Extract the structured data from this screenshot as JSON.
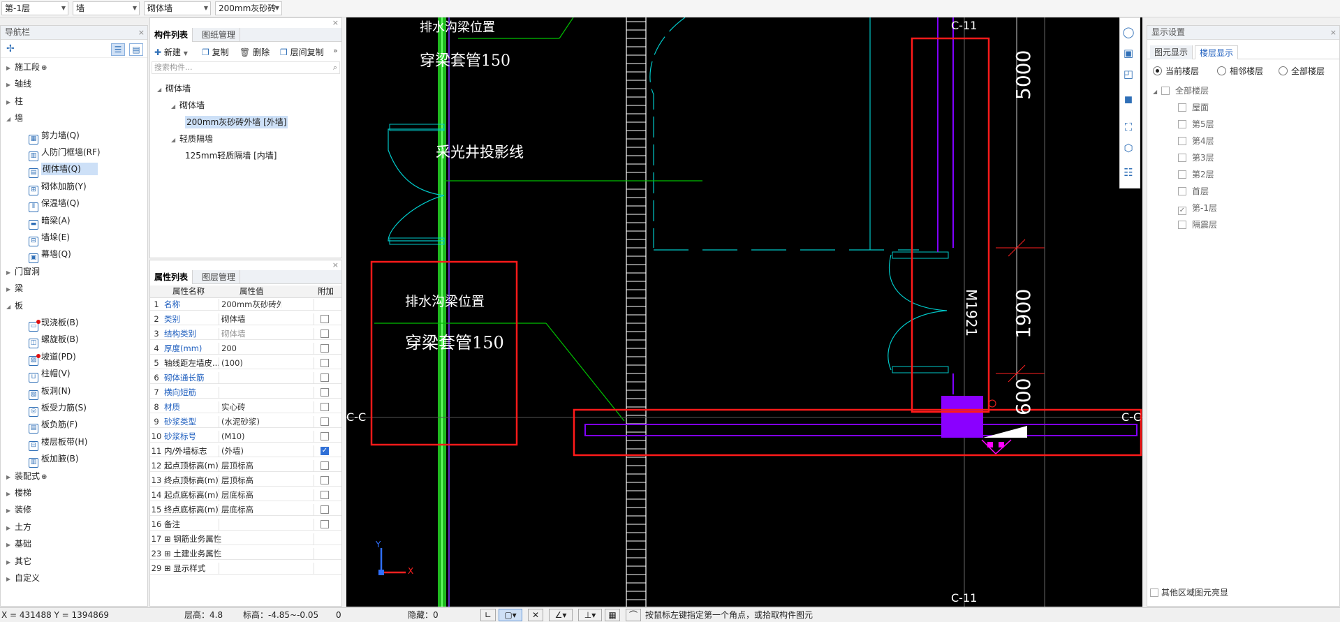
{
  "toolbar": {
    "floor": "第-1层",
    "category": "墙",
    "subcategory": "砌体墙",
    "component": "200mm灰砂砖"
  },
  "nav": {
    "title": "导航栏",
    "close": "×",
    "items": [
      {
        "label": "施工段",
        "level": 0,
        "expanded": false,
        "suffix": "⊕"
      },
      {
        "label": "轴线",
        "level": 0,
        "expanded": false
      },
      {
        "label": "柱",
        "level": 0,
        "expanded": false
      },
      {
        "label": "墙",
        "level": 0,
        "expanded": true
      },
      {
        "label": "剪力墙(Q)",
        "level": 1
      },
      {
        "label": "人防门框墙(RF)",
        "level": 1
      },
      {
        "label": "砌体墙(Q)",
        "level": 1,
        "selected": true
      },
      {
        "label": "砌体加筋(Y)",
        "level": 1
      },
      {
        "label": "保温墙(Q)",
        "level": 1
      },
      {
        "label": "暗梁(A)",
        "level": 1
      },
      {
        "label": "墙垛(E)",
        "level": 1
      },
      {
        "label": "幕墙(Q)",
        "level": 1
      },
      {
        "label": "门窗洞",
        "level": 0,
        "expanded": false
      },
      {
        "label": "梁",
        "level": 0,
        "expanded": false
      },
      {
        "label": "板",
        "level": 0,
        "expanded": true
      },
      {
        "label": "现浇板(B)",
        "level": 1,
        "dot": true
      },
      {
        "label": "螺旋板(B)",
        "level": 1
      },
      {
        "label": "坡道(PD)",
        "level": 1,
        "dot": true
      },
      {
        "label": "柱帽(V)",
        "level": 1
      },
      {
        "label": "板洞(N)",
        "level": 1
      },
      {
        "label": "板受力筋(S)",
        "level": 1
      },
      {
        "label": "板负筋(F)",
        "level": 1
      },
      {
        "label": "楼层板带(H)",
        "level": 1
      },
      {
        "label": "板加腋(B)",
        "level": 1
      },
      {
        "label": "装配式",
        "level": 0,
        "expanded": false,
        "suffix": "⊕"
      },
      {
        "label": "楼梯",
        "level": 0,
        "expanded": false
      },
      {
        "label": "装修",
        "level": 0,
        "expanded": false
      },
      {
        "label": "土方",
        "level": 0,
        "expanded": false
      },
      {
        "label": "基础",
        "level": 0,
        "expanded": false
      },
      {
        "label": "其它",
        "level": 0,
        "expanded": false
      },
      {
        "label": "自定义",
        "level": 0,
        "expanded": false
      }
    ]
  },
  "components": {
    "tabs": [
      "构件列表",
      "图纸管理"
    ],
    "buttons": {
      "new": "新建",
      "copy": "复制",
      "delete": "删除",
      "floor_copy": "层间复制"
    },
    "search_placeholder": "搜索构件...",
    "tree": [
      {
        "label": "砌体墙",
        "level": 0
      },
      {
        "label": "砌体墙",
        "level": 1
      },
      {
        "label": "200mm灰砂砖外墙 [外墙]",
        "level": 2,
        "selected": true
      },
      {
        "label": "轻质隔墙",
        "level": 1
      },
      {
        "label": "125mm轻质隔墙 [内墙]",
        "level": 2
      }
    ]
  },
  "properties": {
    "tabs": [
      "属性列表",
      "图层管理"
    ],
    "headers": {
      "name": "属性名称",
      "value": "属性值",
      "extra": "附加"
    },
    "rows": [
      {
        "n": "1",
        "k": "名称",
        "v": "200mm灰砂砖外...",
        "blue": true,
        "check": null
      },
      {
        "n": "2",
        "k": "类别",
        "v": "砌体墙",
        "blue": true,
        "check": false
      },
      {
        "n": "3",
        "k": "结构类别",
        "v": "砌体墙",
        "blue": true,
        "check": false,
        "grey": true
      },
      {
        "n": "4",
        "k": "厚度(mm)",
        "v": "200",
        "blue": true,
        "check": false
      },
      {
        "n": "5",
        "k": "轴线距左墙皮...",
        "v": "(100)",
        "blue": false,
        "check": false
      },
      {
        "n": "6",
        "k": "砌体通长筋",
        "v": "",
        "blue": true,
        "check": false
      },
      {
        "n": "7",
        "k": "横向短筋",
        "v": "",
        "blue": true,
        "check": false
      },
      {
        "n": "8",
        "k": "材质",
        "v": "实心砖",
        "blue": true,
        "check": false
      },
      {
        "n": "9",
        "k": "砂浆类型",
        "v": "(水泥砂浆)",
        "blue": true,
        "check": false
      },
      {
        "n": "10",
        "k": "砂浆标号",
        "v": "(M10)",
        "blue": true,
        "check": false
      },
      {
        "n": "11",
        "k": "内/外墙标志",
        "v": "(外墙)",
        "blue": false,
        "check": true
      },
      {
        "n": "12",
        "k": "起点顶标高(m)",
        "v": "层顶标高",
        "blue": false,
        "check": false
      },
      {
        "n": "13",
        "k": "终点顶标高(m)",
        "v": "层顶标高",
        "blue": false,
        "check": false
      },
      {
        "n": "14",
        "k": "起点底标高(m)",
        "v": "层底标高",
        "blue": false,
        "check": false
      },
      {
        "n": "15",
        "k": "终点底标高(m)",
        "v": "层底标高",
        "blue": false,
        "check": false
      },
      {
        "n": "16",
        "k": "备注",
        "v": "",
        "blue": false,
        "check": false
      },
      {
        "n": "17",
        "k": "钢筋业务属性",
        "v": "",
        "blue": false,
        "check": null,
        "group": true
      },
      {
        "n": "23",
        "k": "土建业务属性",
        "v": "",
        "blue": false,
        "check": null,
        "group": true
      },
      {
        "n": "29",
        "k": "显示样式",
        "v": "",
        "blue": false,
        "check": null,
        "group": true
      }
    ]
  },
  "canvas": {
    "labels": {
      "axis_top": "C-11",
      "axis_bottom": "C-11",
      "axis_left": "C-C",
      "axis_right": "C-C",
      "text_top": "穿梁套管150",
      "text_top2": "排水沟梁位置",
      "text_skylight": "采光井投影线",
      "text_mid1": "排水沟梁位置",
      "text_mid2": "穿梁套管150",
      "dim1": "5000",
      "dim2": "1900",
      "dim3": "600",
      "door": "M1921",
      "ucs_y": "Y",
      "ucs_x": "X"
    },
    "colors": {
      "cyan": "#00c8c8",
      "green": "#00d000",
      "red": "#ff0000",
      "purple": "#8000ff",
      "magenta": "#ff00ff"
    }
  },
  "display": {
    "title": "显示设置",
    "tabs": [
      "图元显示",
      "楼层显示"
    ],
    "radios": [
      {
        "label": "当前楼层",
        "on": true
      },
      {
        "label": "相邻楼层",
        "on": false
      },
      {
        "label": "全部楼层",
        "on": false
      }
    ],
    "root": "全部楼层",
    "floors": [
      {
        "label": "屋面",
        "checked": false
      },
      {
        "label": "第5层",
        "checked": false
      },
      {
        "label": "第4层",
        "checked": false
      },
      {
        "label": "第3层",
        "checked": false
      },
      {
        "label": "第2层",
        "checked": false
      },
      {
        "label": "首层",
        "checked": false
      },
      {
        "label": "第-1层",
        "checked": true
      },
      {
        "label": "隔震层",
        "checked": false
      }
    ],
    "footer": "其他区域图元亮显"
  },
  "status": {
    "coords": "X = 431488 Y = 1394869",
    "floor_height": "层高：4.8",
    "elevation": "标高：-4.85~-0.05",
    "zero": "0",
    "hidden": "隐藏：0",
    "hint": "按鼠标左键指定第一个角点，或拾取构件图元"
  }
}
